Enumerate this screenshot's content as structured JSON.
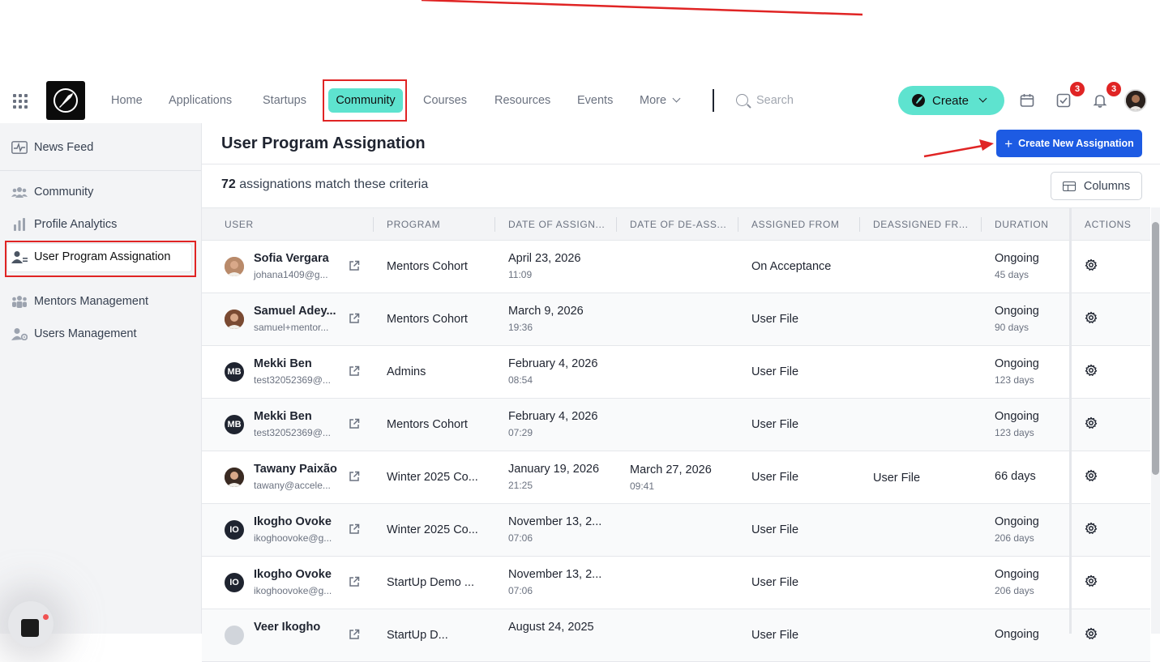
{
  "nav": {
    "items": [
      {
        "label": "Home"
      },
      {
        "label": "Applications"
      },
      {
        "label": "Startups"
      },
      {
        "label": "Community"
      },
      {
        "label": "Courses"
      },
      {
        "label": "Resources"
      },
      {
        "label": "Events"
      },
      {
        "label": "More"
      }
    ],
    "active": "Community",
    "search_placeholder": "Search",
    "create_label": "Create",
    "tasks_badge": "3",
    "notifications_badge": "3"
  },
  "sidebar": {
    "items": [
      {
        "label": "News Feed",
        "icon": "activity-icon"
      },
      {
        "label": "Community",
        "icon": "people-icon"
      },
      {
        "label": "Profile Analytics",
        "icon": "bar-chart-icon"
      },
      {
        "label": "User Program Assignation",
        "icon": "user-list-icon",
        "active": true
      },
      {
        "label": "Mentors Management",
        "icon": "group-icon"
      },
      {
        "label": "Users Management",
        "icon": "user-gear-icon"
      }
    ]
  },
  "main": {
    "title": "User Program Assignation",
    "create_assignation_label": "Create New Assignation",
    "count": "72",
    "count_suffix": "assignations match these criteria",
    "columns_label": "Columns",
    "table": {
      "headers": [
        "USER",
        "PROGRAM",
        "DATE OF ASSIGN...",
        "DATE OF DE-ASS...",
        "ASSIGNED FROM",
        "DEASSIGNED FR...",
        "DURATION",
        "ACTIONS"
      ],
      "rows": [
        {
          "name": "Sofia Vergara",
          "email": "johana1409@g...",
          "avatar": "photo",
          "avatar_color": "#b98a6a",
          "program": "Mentors Cohort",
          "assign_date": "April 23, 2026",
          "assign_time": "11:09",
          "deassign_date": "",
          "deassign_time": "",
          "assigned_from": "On Acceptance",
          "deassigned_from": "",
          "duration": "Ongoing",
          "duration_sub": "45 days"
        },
        {
          "name": "Samuel Adey...",
          "email": "samuel+mentor...",
          "avatar": "photo",
          "avatar_color": "#7a4a32",
          "program": "Mentors Cohort",
          "assign_date": "March 9, 2026",
          "assign_time": "19:36",
          "deassign_date": "",
          "deassign_time": "",
          "assigned_from": "User File",
          "deassigned_from": "",
          "duration": "Ongoing",
          "duration_sub": "90 days"
        },
        {
          "name": "Mekki Ben",
          "email": "test32052369@...",
          "avatar": "MB",
          "avatar_color": "#1f2430",
          "program": "Admins",
          "assign_date": "February 4, 2026",
          "assign_time": "08:54",
          "deassign_date": "",
          "deassign_time": "",
          "assigned_from": "User File",
          "deassigned_from": "",
          "duration": "Ongoing",
          "duration_sub": "123 days"
        },
        {
          "name": "Mekki Ben",
          "email": "test32052369@...",
          "avatar": "MB",
          "avatar_color": "#1f2430",
          "program": "Mentors Cohort",
          "assign_date": "February 4, 2026",
          "assign_time": "07:29",
          "deassign_date": "",
          "deassign_time": "",
          "assigned_from": "User File",
          "deassigned_from": "",
          "duration": "Ongoing",
          "duration_sub": "123 days"
        },
        {
          "name": "Tawany Paixão",
          "email": "tawany@accele...",
          "avatar": "photo",
          "avatar_color": "#3a2a22",
          "program": "Winter 2025 Co...",
          "assign_date": "January 19, 2026",
          "assign_time": "21:25",
          "deassign_date": "March 27, 2026",
          "deassign_time": "09:41",
          "assigned_from": "User File",
          "deassigned_from": "User File",
          "duration": "66 days",
          "duration_sub": ""
        },
        {
          "name": "Ikogho Ovoke",
          "email": "ikoghoovoke@g...",
          "avatar": "IO",
          "avatar_color": "#1f2430",
          "program": "Winter 2025 Co...",
          "assign_date": "November 13, 2...",
          "assign_time": "07:06",
          "deassign_date": "",
          "deassign_time": "",
          "assigned_from": "User File",
          "deassigned_from": "",
          "duration": "Ongoing",
          "duration_sub": "206 days"
        },
        {
          "name": "Ikogho Ovoke",
          "email": "ikoghoovoke@g...",
          "avatar": "IO",
          "avatar_color": "#1f2430",
          "program": "StartUp Demo ...",
          "assign_date": "November 13, 2...",
          "assign_time": "07:06",
          "deassign_date": "",
          "deassign_time": "",
          "assigned_from": "User File",
          "deassigned_from": "",
          "duration": "Ongoing",
          "duration_sub": "206 days"
        },
        {
          "name": "Veer Ikogho",
          "email": "",
          "avatar": "",
          "avatar_color": "#d1d5db",
          "program": "StartUp D...",
          "assign_date": "August 24, 2025",
          "assign_time": "",
          "deassign_date": "",
          "deassign_time": "",
          "assigned_from": "User File",
          "deassigned_from": "",
          "duration": "Ongoing",
          "duration_sub": ""
        }
      ]
    }
  },
  "colors": {
    "accent": "#5ee3cf",
    "primary_button": "#1d5be3",
    "badge": "#e02424",
    "annotation": "#e02424"
  }
}
